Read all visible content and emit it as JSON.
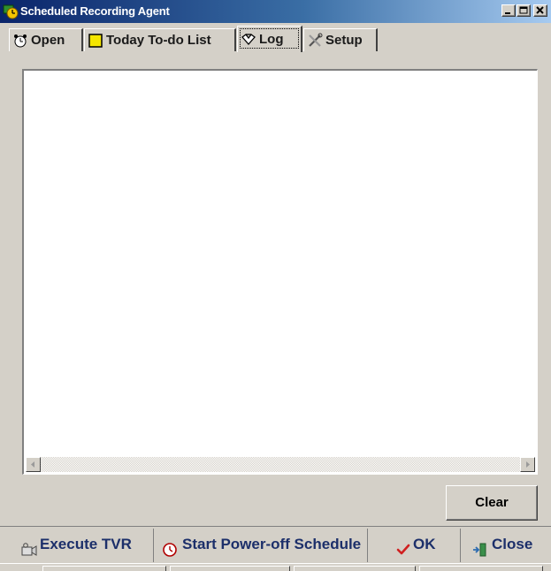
{
  "window": {
    "title": "Scheduled Recording Agent",
    "controls": {
      "minimize": "minimize-icon",
      "maximize": "maximize-icon",
      "close": "close-icon"
    }
  },
  "tabs": [
    {
      "label": "Open",
      "icon": "alarm-clock-icon",
      "active": false
    },
    {
      "label": "Today To-do List",
      "icon": "note-icon",
      "active": false
    },
    {
      "label": "Log",
      "icon": "log-icon",
      "active": true
    },
    {
      "label": "Setup",
      "icon": "tools-icon",
      "active": false
    }
  ],
  "log": {
    "content": ""
  },
  "actions": {
    "clear_label": "Clear"
  },
  "toolbar": {
    "execute_label": "Execute TVR",
    "power_off_label": "Start Power-off Schedule",
    "ok_label": "OK",
    "close_label": "Close"
  },
  "colors": {
    "titlebar_start": "#0a246a",
    "titlebar_end": "#a6caf0",
    "face": "#d4d0c8",
    "toolbar_text": "#1c2f6a"
  }
}
